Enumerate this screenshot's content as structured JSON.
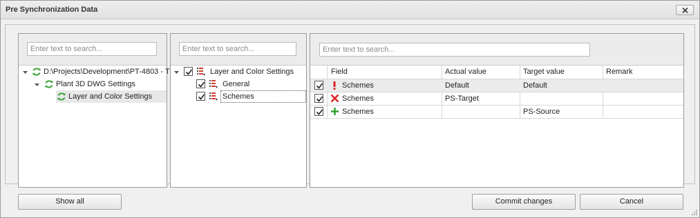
{
  "window": {
    "title": "Pre Synchronization Data"
  },
  "left_panel": {
    "search_placeholder": "Enter text to search...",
    "tree": [
      {
        "label": "D:\\Projects\\Development\\PT-4803 - T",
        "icon": "sync-icon",
        "expanded": true
      },
      {
        "label": "Plant 3D DWG Settings",
        "icon": "sync-icon",
        "expanded": true
      },
      {
        "label": "Layer and Color Settings",
        "icon": "sync-icon",
        "selected": true
      }
    ]
  },
  "middle_panel": {
    "search_placeholder": "Enter text to search...",
    "tree": [
      {
        "label": "Layer and Color Settings",
        "checked": true,
        "expanded": true
      },
      {
        "label": "General",
        "checked": true
      },
      {
        "label": "Schemes",
        "checked": true,
        "focused": true
      }
    ]
  },
  "right_panel": {
    "search_placeholder": "Enter text to search...",
    "columns": [
      "Field",
      "Actual value",
      "Target value",
      "Remark"
    ],
    "rows": [
      {
        "checked": true,
        "status_icon": "exclamation-icon",
        "field": "Schemes",
        "actual": "Default",
        "target": "Default",
        "remark": ""
      },
      {
        "checked": true,
        "status_icon": "red-x-icon",
        "field": "Schemes",
        "actual": "PS-Target",
        "target": "",
        "remark": ""
      },
      {
        "checked": true,
        "status_icon": "green-plus-icon",
        "field": "Schemes",
        "actual": "",
        "target": "PS-Source",
        "remark": ""
      }
    ]
  },
  "buttons": {
    "show_all": "Show all",
    "commit": "Commit changes",
    "cancel": "Cancel"
  },
  "colors": {
    "sync_green": "#3aa23a",
    "error_red": "#e02020",
    "add_green": "#2ea02e",
    "list_red": "#d23c2c"
  }
}
